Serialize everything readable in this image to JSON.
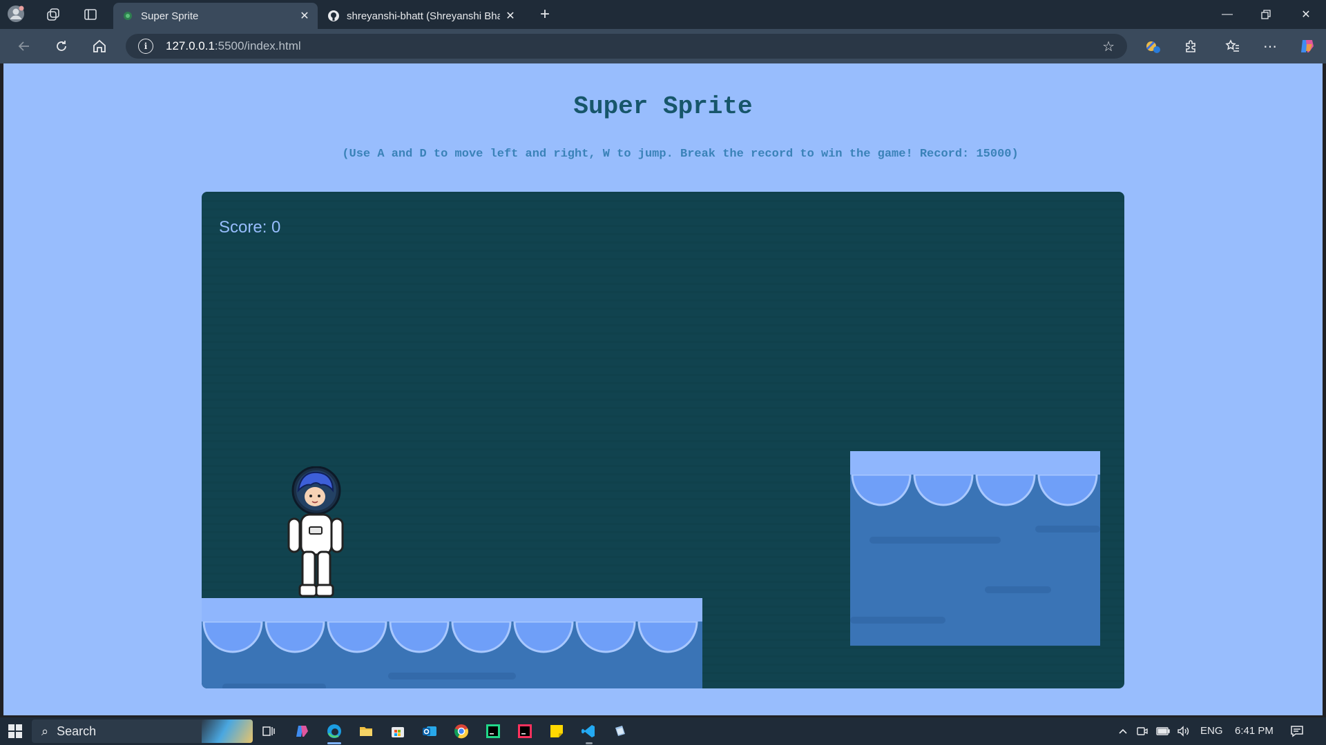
{
  "browser": {
    "tabs": [
      {
        "title": "Super Sprite",
        "active": true
      },
      {
        "title": "shreyanshi-bhatt (Shreyanshi Bhatt)",
        "active": false
      }
    ],
    "url": {
      "host": "127.0.0.1",
      "path": ":5500/index.html"
    }
  },
  "page": {
    "title": "Super Sprite",
    "instructions": "(Use A and D to move left and right, W to jump. Break the record to win the game! Record: 15000)"
  },
  "game": {
    "score_label": "Score: 0",
    "colors": {
      "page_bg": "#98bdfd",
      "game_bg": "#11434f",
      "platform_top": "#8fb6fd",
      "platform_body": "#3a74b6"
    }
  },
  "taskbar": {
    "search_label": "Search",
    "language": "ENG",
    "time": "6:41 PM"
  }
}
